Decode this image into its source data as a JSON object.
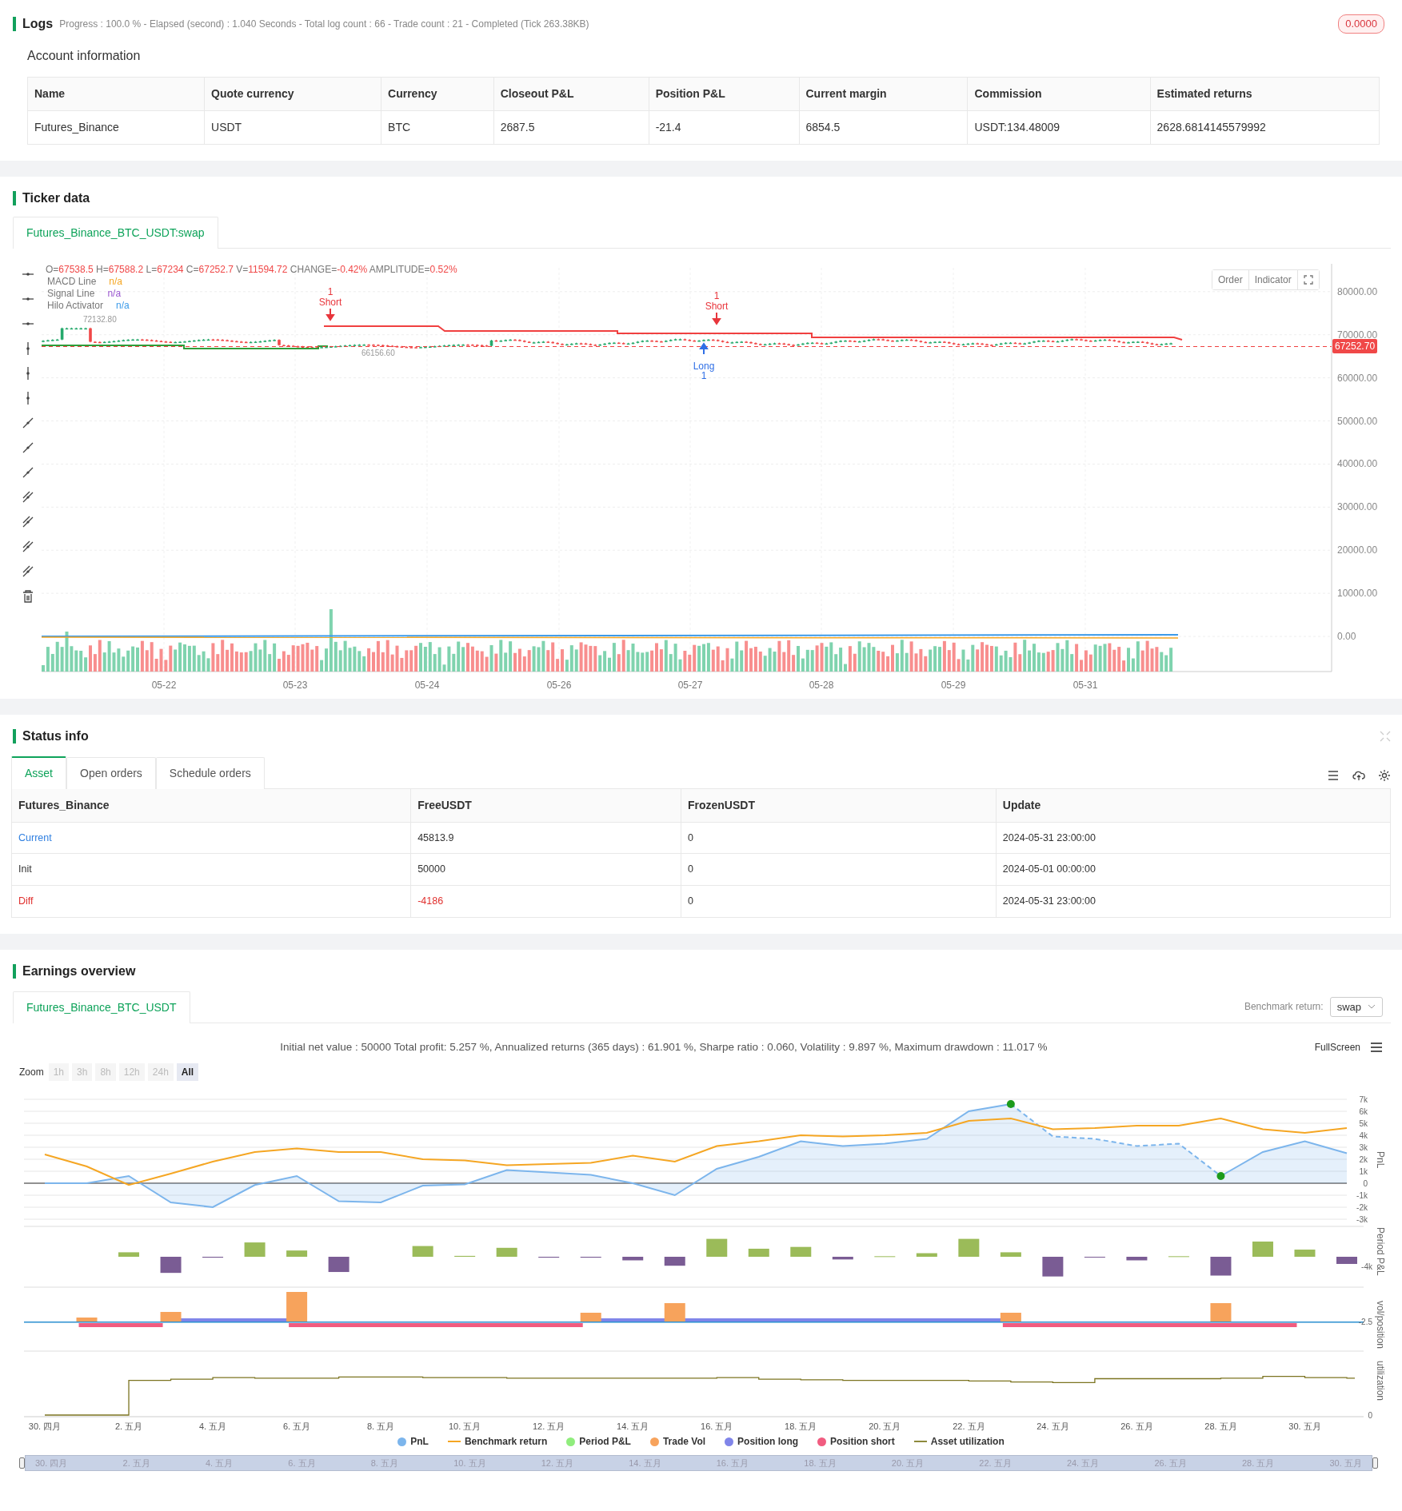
{
  "logs": {
    "title": "Logs",
    "summary": "Progress : 100.0 % - Elapsed (second) : 1.040  Seconds - Total log count : 66 - Trade count : 21 - Completed (Tick 263.38KB)",
    "badge": "0.0000"
  },
  "account": {
    "title": "Account information",
    "columns": [
      "Name",
      "Quote currency",
      "Currency",
      "Closeout P&L",
      "Position P&L",
      "Current margin",
      "Commission",
      "Estimated returns"
    ],
    "rows": [
      [
        "Futures_Binance",
        "USDT",
        "BTC",
        "2687.5",
        "-21.4",
        "6854.5",
        "USDT:134.48009",
        "2628.6814145579992"
      ]
    ]
  },
  "ticker": {
    "title": "Ticker data",
    "tabs": [
      {
        "label": "Futures_Binance_BTC_USDT:swap",
        "selected": true
      }
    ],
    "readout": [
      {
        "label": "O=",
        "value": "67538.5"
      },
      {
        "label": " H=",
        "value": "67588.2"
      },
      {
        "label": " L=",
        "value": "67234"
      },
      {
        "label": " C=",
        "value": "67252.7"
      },
      {
        "label": " V=",
        "value": "11594.72"
      },
      {
        "label": " CHANGE=",
        "value": "-0.42%"
      },
      {
        "label": " AMPLITUDE=",
        "value": "0.52%"
      }
    ],
    "indicators": [
      {
        "name": "MACD Line",
        "value": "n/a",
        "color": "#f5a623"
      },
      {
        "name": "Signal Line",
        "value": "n/a",
        "color": "#9b59d0"
      },
      {
        "name": "Hilo Activator",
        "value": "n/a",
        "color": "#3d9be9"
      }
    ],
    "buttons": [
      "Order",
      "Indicator"
    ],
    "y_labels": [
      "80000.00",
      "70000.00",
      "60000.00",
      "50000.00",
      "40000.00",
      "30000.00",
      "20000.00",
      "10000.00",
      "0.00"
    ],
    "price_tag": "67252.70",
    "x_labels": [
      "05-22",
      "05-23",
      "05-24",
      "05-26",
      "05-27",
      "05-28",
      "05-29",
      "05-31"
    ],
    "extremes": [
      "72132.80",
      "66156.60"
    ],
    "markers": [
      {
        "kind": "short",
        "count": "1",
        "label": "Short"
      },
      {
        "kind": "short",
        "count": "1",
        "label": "Short"
      },
      {
        "kind": "long",
        "count": "1",
        "label": "Long"
      }
    ]
  },
  "status": {
    "title": "Status info",
    "tabs": [
      {
        "label": "Asset",
        "selected": true
      },
      {
        "label": "Open orders",
        "selected": false
      },
      {
        "label": "Schedule orders",
        "selected": false
      }
    ],
    "columns": [
      "Futures_Binance",
      "FreeUSDT",
      "FrozenUSDT",
      "Update"
    ],
    "rows": [
      {
        "kind": "current",
        "cells": [
          "Current",
          "45813.9",
          "0",
          "2024-05-31 23:00:00"
        ]
      },
      {
        "kind": "plain",
        "cells": [
          "Init",
          "50000",
          "0",
          "2024-05-01 00:00:00"
        ]
      },
      {
        "kind": "diff",
        "cells": [
          "Diff",
          "-4186",
          "0",
          "2024-05-31 23:00:00"
        ]
      }
    ]
  },
  "earnings": {
    "title": "Earnings overview",
    "tabs": [
      {
        "label": "Futures_Binance_BTC_USDT",
        "selected": true
      }
    ],
    "benchmark_label": "Benchmark return:",
    "benchmark_value": "swap",
    "stats": "Initial net value : 50000 Total profit: 5.257 %, Annualized returns (365 days) : 61.901 %, Sharpe ratio : 0.060, Volatility : 9.897 %, Maximum drawdown : 11.017 %",
    "fullscreen": "FullScreen",
    "zoom_label": "Zoom",
    "zoom_buttons": [
      {
        "label": "1h",
        "selected": false
      },
      {
        "label": "3h",
        "selected": false
      },
      {
        "label": "8h",
        "selected": false
      },
      {
        "label": "12h",
        "selected": false
      },
      {
        "label": "24h",
        "selected": false
      },
      {
        "label": "All",
        "selected": true
      }
    ],
    "chart_data": {
      "type": "area",
      "ylabel": "PnL",
      "grid": true,
      "legend": "bottom",
      "series": [
        {
          "name": "PnL",
          "type": "area",
          "color": "#7cb5ec",
          "values": [
            0,
            0,
            600,
            -1600,
            -2000,
            -150,
            600,
            -1500,
            -1600,
            -200,
            -100,
            1100,
            900,
            700,
            0,
            -1000,
            1200,
            2200,
            3500,
            3100,
            3300,
            3700,
            6000,
            6600,
            3900,
            3700,
            3100,
            3300,
            600,
            2600,
            3500,
            2500
          ]
        },
        {
          "name": "Benchmark return",
          "type": "line",
          "color": "#f5a623",
          "values": [
            2400,
            1400,
            -150,
            800,
            1800,
            2600,
            2900,
            2600,
            2600,
            2000,
            1900,
            1500,
            1600,
            1700,
            2300,
            1800,
            3100,
            3500,
            4000,
            3900,
            4000,
            4200,
            5200,
            5400,
            4500,
            4600,
            4800,
            4800,
            5400,
            4500,
            4200,
            4600
          ]
        }
      ],
      "ylim": [
        -3000,
        7000
      ],
      "yticks": [
        {
          "value": 7000,
          "label": "7k"
        },
        {
          "value": 6000,
          "label": "6k"
        },
        {
          "value": 5000,
          "label": "5k"
        },
        {
          "value": 4000,
          "label": "4k"
        },
        {
          "value": 3000,
          "label": "3k"
        },
        {
          "value": 2000,
          "label": "2k"
        },
        {
          "value": 1000,
          "label": "1k"
        },
        {
          "value": 0,
          "label": "0"
        },
        {
          "value": -1000,
          "label": "-1k"
        },
        {
          "value": -2000,
          "label": "-2k"
        },
        {
          "value": -3000,
          "label": "-3k"
        }
      ]
    },
    "x_labels": [
      "30. 四月",
      "2. 五月",
      "4. 五月",
      "6. 五月",
      "8. 五月",
      "10. 五月",
      "12. 五月",
      "14. 五月",
      "16. 五月",
      "18. 五月",
      "20. 五月",
      "22. 五月",
      "24. 五月",
      "26. 五月",
      "28. 五月",
      "30. 五月"
    ],
    "panes": [
      {
        "title": "Period P&L",
        "tick": "-4k"
      },
      {
        "title": "vol/position",
        "tick": "-2.5"
      },
      {
        "title": "utilization",
        "tick": "0"
      }
    ],
    "legend": [
      {
        "name": "Period P&L",
        "kind": "dot",
        "color": "#90ed7d"
      },
      {
        "name": "Trade Vol",
        "kind": "dot",
        "color": "#f7a35c"
      },
      {
        "name": "Position long",
        "kind": "dot",
        "color": "#8085e9"
      },
      {
        "name": "Position short",
        "kind": "dot",
        "color": "#f15c80"
      },
      {
        "name": "Asset utilization",
        "kind": "line",
        "color": "#8d8a3c"
      }
    ],
    "navigator": [
      "30. 四月",
      "2. 五月",
      "4. 五月",
      "6. 五月",
      "8. 五月",
      "10. 五月",
      "12. 五月",
      "14. 五月",
      "16. 五月",
      "18. 五月",
      "20. 五月",
      "22. 五月",
      "24. 五月",
      "26. 五月",
      "28. 五月",
      "30. 五月"
    ]
  }
}
